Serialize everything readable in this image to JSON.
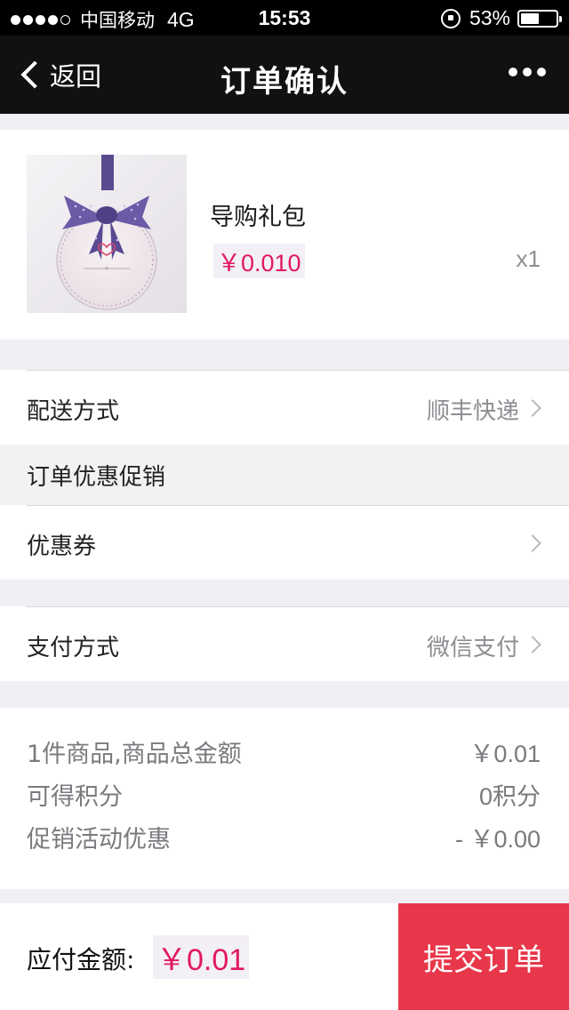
{
  "status_bar": {
    "carrier": "中国移动",
    "network": "4G",
    "time": "15:53",
    "battery_percent": "53%",
    "battery_level": 0.53,
    "signal_bars_filled": 4,
    "signal_bars_total": 5
  },
  "nav": {
    "back_label": "返回",
    "title": "订单确认",
    "more_icon": "more-dots-icon"
  },
  "product": {
    "name": "导购礼包",
    "price": "￥0.010",
    "quantity": "x1",
    "image_icon": "gift-tag-bow-image"
  },
  "delivery": {
    "label": "配送方式",
    "value": "顺丰快递"
  },
  "promotion_section": {
    "label": "订单优惠促销"
  },
  "coupon": {
    "label": "优惠券",
    "value": ""
  },
  "payment": {
    "label": "支付方式",
    "value": "微信支付"
  },
  "summary": {
    "items_label": "1件商品,商品总金额",
    "items_value": "￥0.01",
    "points_label": "可得积分",
    "points_value": "0积分",
    "promo_label": "促销活动优惠",
    "promo_value": "- ￥0.00"
  },
  "bottom": {
    "payable_label": "应付金额:",
    "payable_amount": "￥0.01",
    "submit_label": "提交订单"
  },
  "colors": {
    "accent_price": "#e0195e",
    "submit_button": "#e8374a",
    "nav_background": "#111111",
    "page_background": "#efeff4"
  }
}
